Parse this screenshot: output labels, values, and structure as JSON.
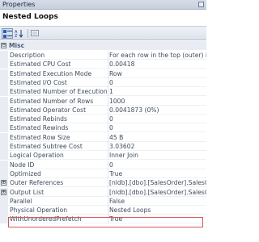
{
  "window": {
    "title": "Properties"
  },
  "object": {
    "name": "Nested Loops"
  },
  "category": {
    "label": "Misc",
    "expander": "⊟"
  },
  "properties": [
    {
      "name": "Description",
      "value": "For each row in the top (outer) inpu"
    },
    {
      "name": "Estimated CPU Cost",
      "value": "0.00418"
    },
    {
      "name": "Estimated Execution Mode",
      "value": "Row"
    },
    {
      "name": "Estimated I/O Cost",
      "value": "0"
    },
    {
      "name": "Estimated Number of Executions",
      "value": "1"
    },
    {
      "name": "Estimated Number of Rows",
      "value": "1000"
    },
    {
      "name": "Estimated Operator Cost",
      "value": "0.0041873 (0%)"
    },
    {
      "name": "Estimated Rebinds",
      "value": "0"
    },
    {
      "name": "Estimated Rewinds",
      "value": "0"
    },
    {
      "name": "Estimated Row Size",
      "value": "45 B"
    },
    {
      "name": "Estimated Subtree Cost",
      "value": "3.03602"
    },
    {
      "name": "Logical Operation",
      "value": "Inner Join"
    },
    {
      "name": "Node ID",
      "value": "0"
    },
    {
      "name": "Optimized",
      "value": "True"
    },
    {
      "name": "Outer References",
      "value": "[nldb].[dbo].[SalesOrder].SalesOrde",
      "expander": "⊞"
    },
    {
      "name": "Output List",
      "value": "[nldb].[dbo].[SalesOrder].SalesOrde",
      "expander": "⊞"
    },
    {
      "name": "Parallel",
      "value": "False"
    },
    {
      "name": "Physical Operation",
      "value": "Nested Loops"
    },
    {
      "name": "WithUnorderedPrefetch",
      "value": "True"
    }
  ]
}
